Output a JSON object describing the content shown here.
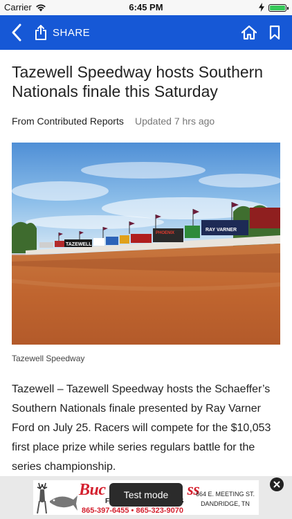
{
  "status_bar": {
    "carrier": "Carrier",
    "time": "6:45 PM"
  },
  "app_bar": {
    "share_label": "SHARE",
    "background_color": "#1658d6"
  },
  "article": {
    "headline": "Tazewell Speedway hosts Southern Nationals finale this Saturday",
    "byline": "From Contributed Reports",
    "updated": "Updated 7 hrs ago",
    "photo": {
      "caption": "Tazewell Speedway",
      "signs": [
        "TAZEWELL",
        "PHOENIX",
        "RAY VARNER"
      ]
    },
    "body": "Tazewell – Tazewell Speedway hosts the Schaeffer’s Southern Nationals finale presented by Ray Varner Ford on July 25. Racers will compete for the $10,053 first place prize while series regulars battle for the series championship."
  },
  "ad": {
    "brand": "Buckingham Glass",
    "brand_visible": "Buc",
    "brand_visible_end": "ss",
    "subtitle": "FI",
    "subtitle_end": "S",
    "phones": "865-397-6455 • 865-323-9070",
    "address_line1": "664 E. MEETING ST.",
    "address_line2": "DANDRIDGE, TN"
  },
  "toast": {
    "label": "Test mode"
  }
}
